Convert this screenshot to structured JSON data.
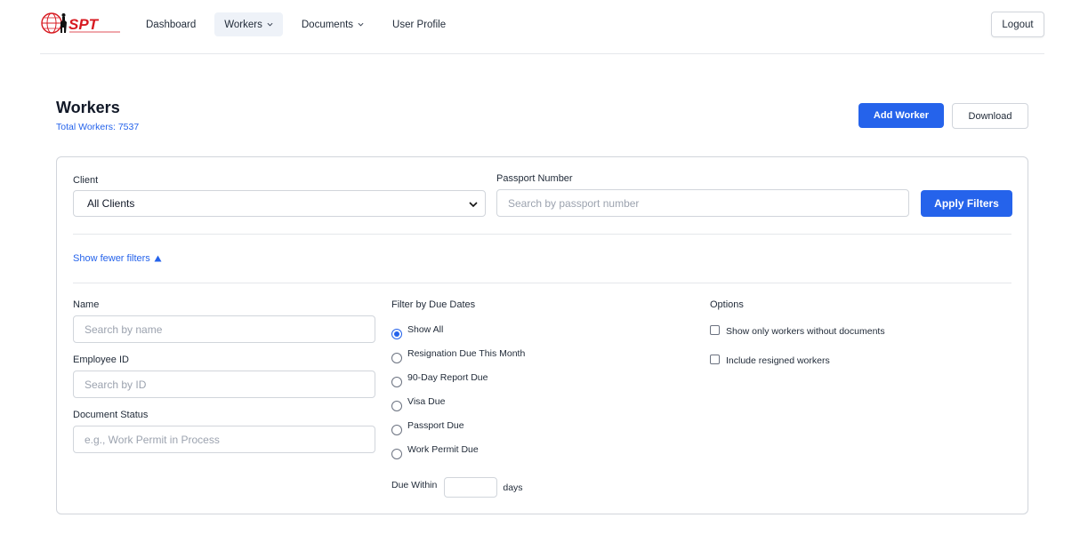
{
  "brand": {
    "logo_text": "SPT"
  },
  "nav": {
    "items": [
      {
        "label": "Dashboard",
        "has_menu": false,
        "active": false
      },
      {
        "label": "Workers",
        "has_menu": true,
        "active": true
      },
      {
        "label": "Documents",
        "has_menu": true,
        "active": false
      },
      {
        "label": "User Profile",
        "has_menu": false,
        "active": false
      }
    ],
    "logout_label": "Logout"
  },
  "page": {
    "title": "Workers",
    "total_workers": "Total Workers: 7537",
    "add_worker_label": "Add Worker",
    "download_label": "Download"
  },
  "filters": {
    "client": {
      "label": "Client",
      "selected": "All Clients"
    },
    "passport": {
      "label": "Passport Number",
      "placeholder": "Search by passport number"
    },
    "apply_label": "Apply Filters",
    "toggle_label": "Show fewer filters",
    "name": {
      "label": "Name",
      "placeholder": "Search by name"
    },
    "employee_id": {
      "label": "Employee ID",
      "placeholder": "Search by ID"
    },
    "document_status": {
      "label": "Document Status",
      "placeholder": "e.g., Work Permit in Process"
    },
    "due_dates": {
      "label": "Filter by Due Dates",
      "options": [
        {
          "label": "Show All",
          "checked": true
        },
        {
          "label": "Resignation Due This Month",
          "checked": false
        },
        {
          "label": "90-Day Report Due",
          "checked": false
        },
        {
          "label": "Visa Due",
          "checked": false
        },
        {
          "label": "Passport Due",
          "checked": false
        },
        {
          "label": "Work Permit Due",
          "checked": false
        }
      ],
      "due_within_label": "Due Within",
      "days_label": "days"
    },
    "options": {
      "label": "Options",
      "checkboxes": [
        {
          "label": "Show only workers without documents",
          "checked": false
        },
        {
          "label": "Include resigned workers",
          "checked": false
        }
      ]
    }
  },
  "colors": {
    "primary": "#2563eb",
    "brand_red": "#d71920"
  }
}
